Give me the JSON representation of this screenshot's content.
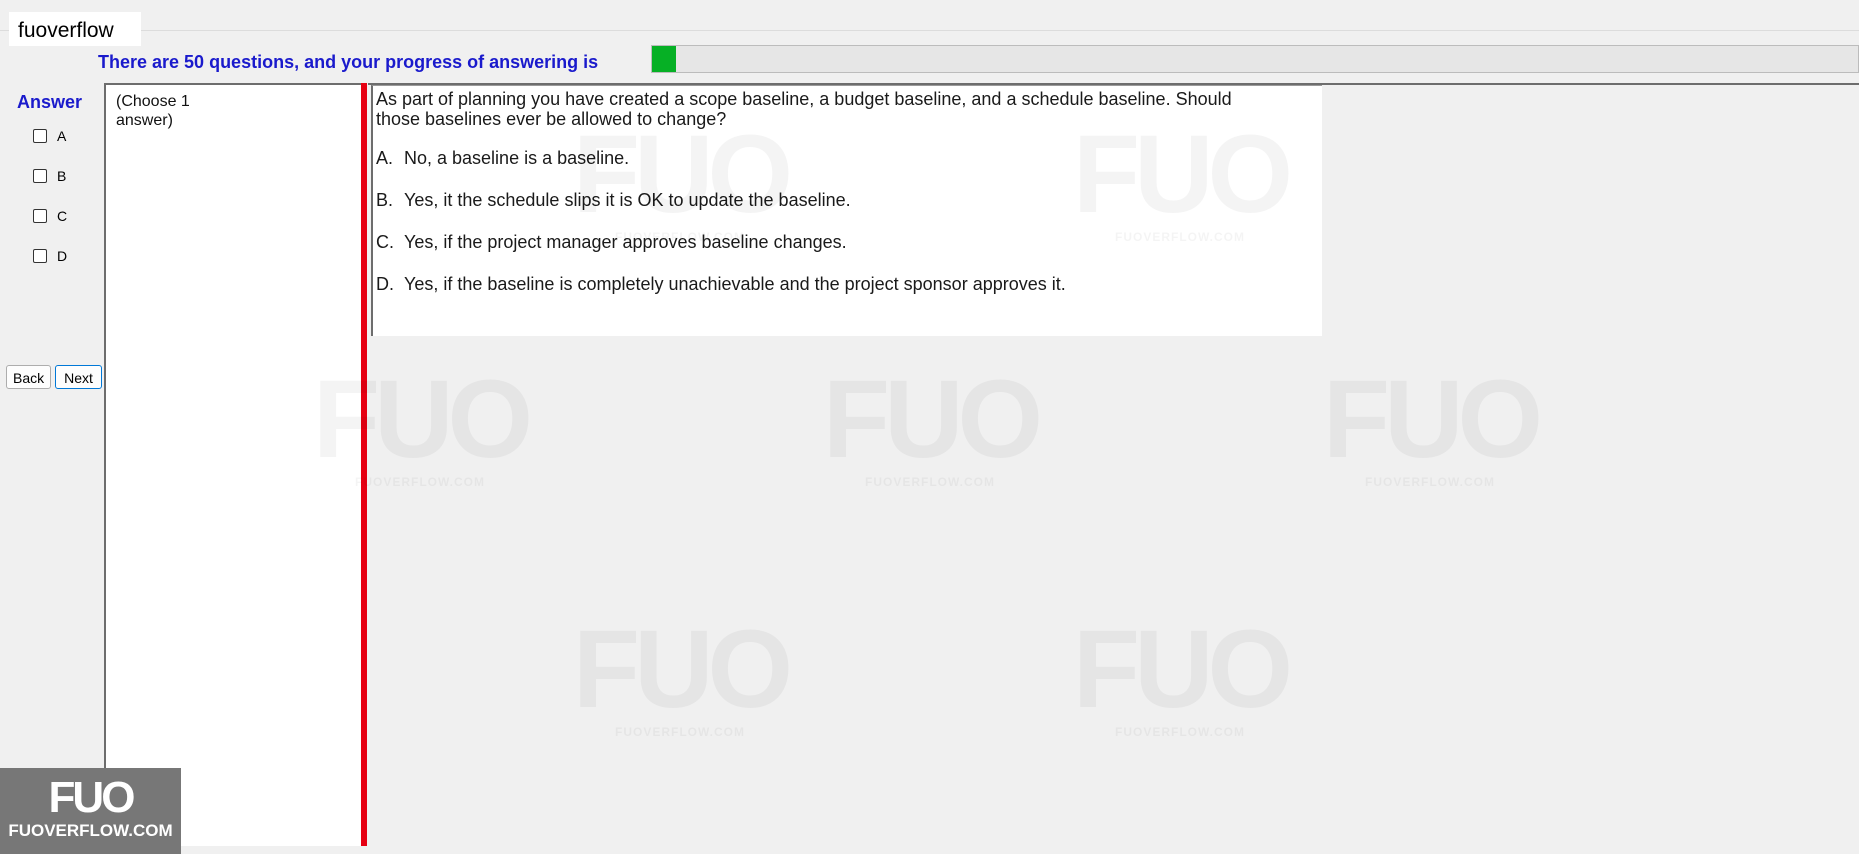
{
  "window": {
    "title": "fuoverflow"
  },
  "progress": {
    "label": "There are 50 questions, and your progress of answering is",
    "fraction": 0.02,
    "fill_color": "#06b025"
  },
  "answer_panel": {
    "title": "Answer",
    "options": [
      "A",
      "B",
      "C",
      "D"
    ]
  },
  "nav": {
    "back_label": "Back",
    "next_label": "Next"
  },
  "choose_panel": {
    "instruction": "(Choose 1 answer)"
  },
  "question": {
    "stem": "As part of planning you have created a scope baseline, a budget baseline, and a schedule baseline. Should those baselines ever be allowed to change?",
    "choices": [
      {
        "letter": "A.",
        "text": "No, a baseline is a baseline."
      },
      {
        "letter": "B.",
        "text": "Yes, it the schedule slips it is OK to update the baseline."
      },
      {
        "letter": "C.",
        "text": "Yes, if the project manager approves baseline changes."
      },
      {
        "letter": "D.",
        "text": "Yes, if the baseline is completely unachievable and the project sponsor approves it."
      }
    ]
  },
  "watermark": {
    "mark": "FUO",
    "site": "FUOVERFLOW.COM"
  },
  "logo": {
    "mark": "FUO",
    "site": "FUOVERFLOW.COM"
  },
  "colors": {
    "accent_blue": "#1a1acc",
    "divider_red": "#e60012"
  }
}
